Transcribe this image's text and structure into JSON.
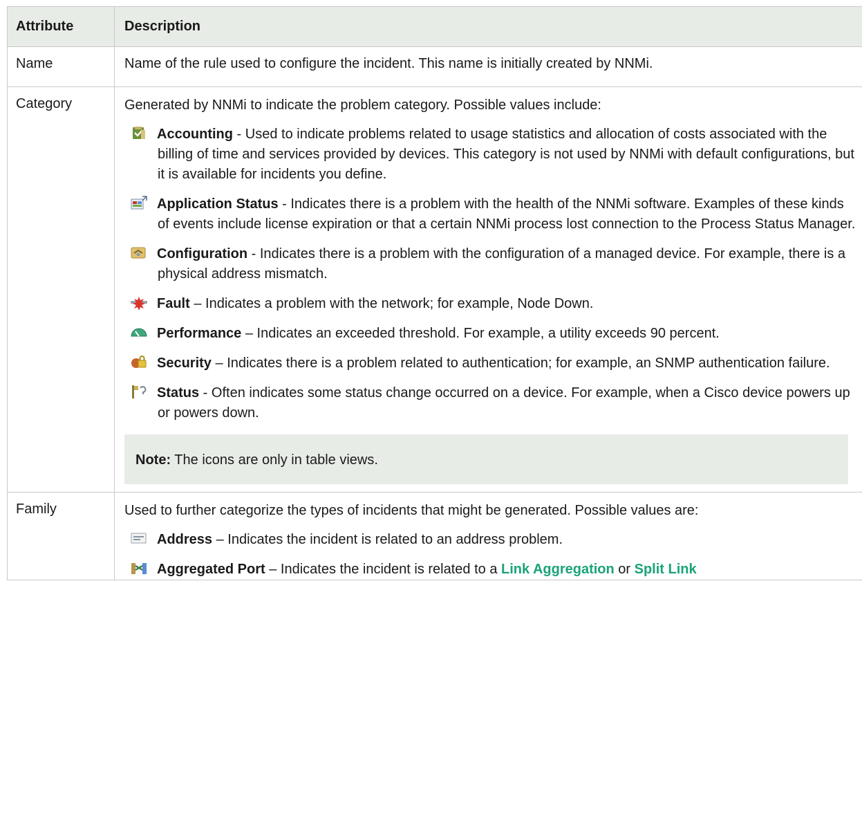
{
  "table": {
    "headers": [
      "Attribute",
      "Description"
    ],
    "name_row": {
      "attribute": "Name",
      "description": "Name of the rule used to configure the incident. This name is initially created by NNMi."
    },
    "category_row": {
      "attribute": "Category",
      "intro": "Generated by NNMi to indicate the problem category. Possible values include:",
      "values": [
        {
          "icon": "accounting-icon",
          "term": "Accounting",
          "sep": " - ",
          "text": "Used to indicate problems related to usage statistics and allocation of costs associated with the billing of time and services provided by devices. This category is not used by NNMi with default configurations, but it is available for incidents you define."
        },
        {
          "icon": "application-status-icon",
          "term": "Application Status",
          "sep": " - ",
          "text": "Indicates there is a problem with the health of the NNMi software. Examples of these kinds of events include license expiration or that a certain NNMi process lost connection to the Process Status Manager."
        },
        {
          "icon": "configuration-icon",
          "term": "Configuration",
          "sep": " - ",
          "text": "Indicates there is a problem with the configuration of a managed device. For example, there is a physical address mismatch."
        },
        {
          "icon": "fault-icon",
          "term": "Fault",
          "sep": " – ",
          "text": "Indicates a problem with the network; for example, Node Down."
        },
        {
          "icon": "performance-icon",
          "term": "Performance",
          "sep": " – ",
          "text": "Indicates an exceeded threshold. For example, a utility exceeds 90 percent."
        },
        {
          "icon": "security-icon",
          "term": "Security",
          "sep": " – ",
          "text": "Indicates there is a problem related to authentication; for example, an SNMP authentication failure."
        },
        {
          "icon": "status-icon",
          "term": "Status",
          "sep": " - ",
          "text": "Often indicates some status change occurred on a device. For example, when a Cisco device powers up or powers down."
        }
      ],
      "note_label": "Note:",
      "note_text": " The icons are only in table views."
    },
    "family_row": {
      "attribute": "Family",
      "intro": "Used to further categorize the types of incidents that might be generated. Possible values are:",
      "values": [
        {
          "icon": "address-icon",
          "term": "Address",
          "sep": " – ",
          "text": "Indicates the incident is related to an address problem."
        }
      ],
      "aggregated": {
        "icon": "aggregated-port-icon",
        "term": "Aggregated Port",
        "text_before": " – Indicates the incident is related to a ",
        "link1": "Link Aggregation",
        "text_middle": " or ",
        "link2": "Split Link"
      }
    }
  },
  "colors": {
    "header_bg": "#e8ece7",
    "note_bg": "#e8ece7",
    "link": "#1aa37a",
    "border": "#c9c9c9"
  }
}
